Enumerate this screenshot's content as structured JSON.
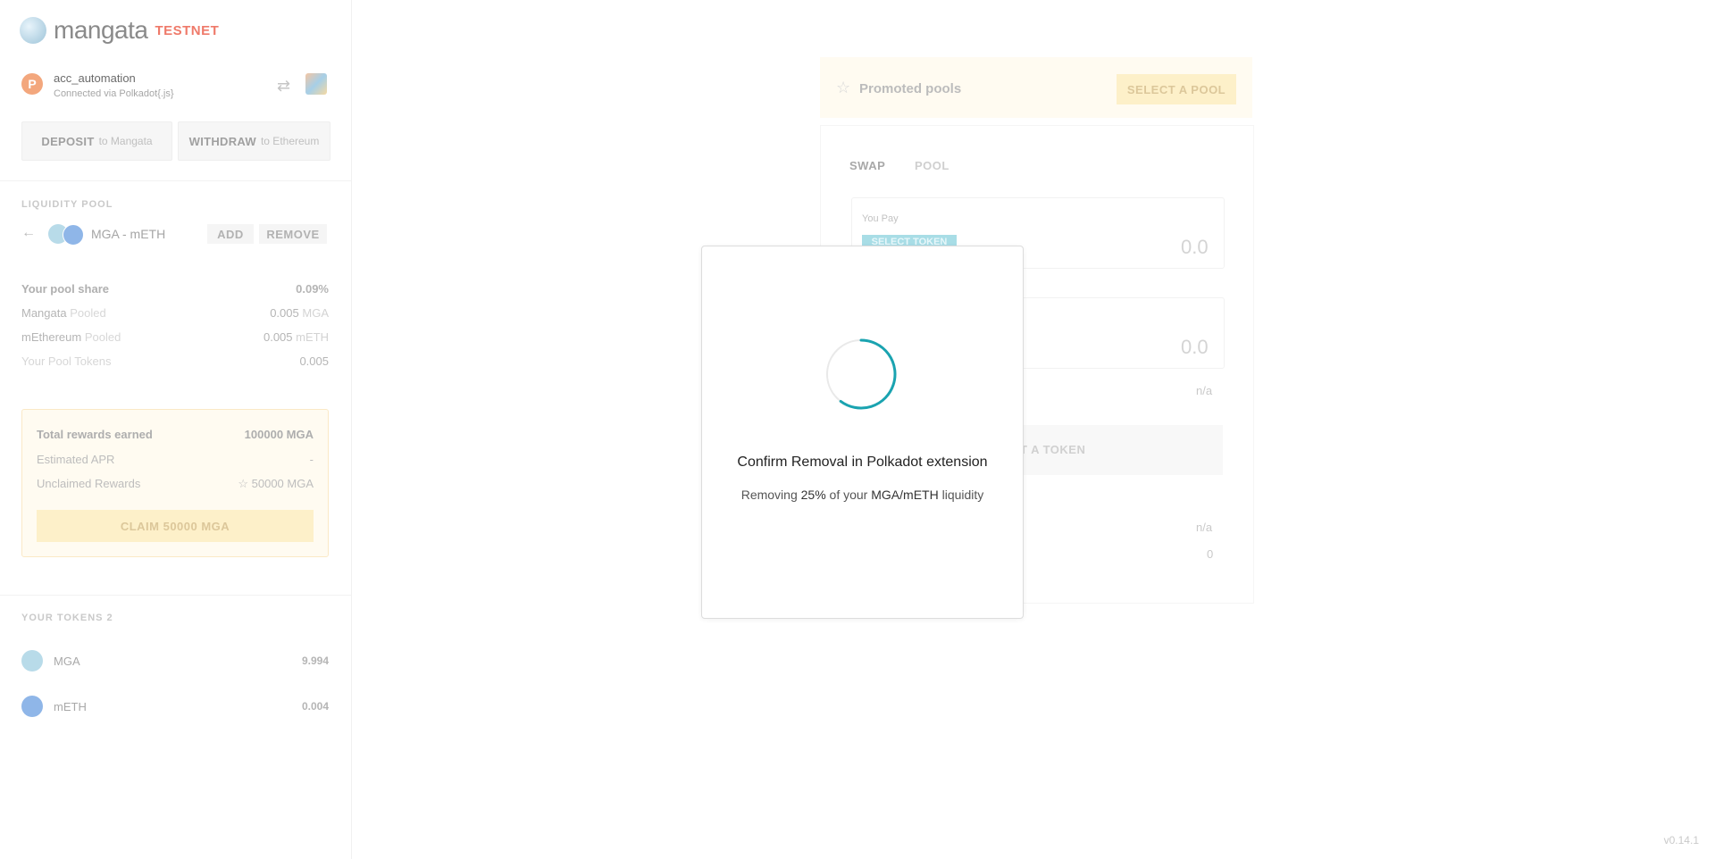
{
  "app": {
    "logo_text": "mangata",
    "badge": "TESTNET",
    "version": "v0.14.1"
  },
  "account": {
    "name": "acc_automation",
    "connection": "Connected via Polkadot{.js}",
    "avatar_letter": "P"
  },
  "actions": {
    "deposit_label": "DEPOSIT",
    "deposit_sub": "to Mangata",
    "withdraw_label": "WITHDRAW",
    "withdraw_sub": "to Ethereum"
  },
  "liquidity_pool": {
    "section_label": "LIQUIDITY POOL",
    "pair": "MGA - mETH",
    "add_label": "ADD",
    "remove_label": "REMOVE",
    "stats": [
      {
        "label": "Your pool share",
        "value": "0.09%"
      },
      {
        "label_main": "Mangata",
        "label_sub": "Pooled",
        "value": "0.005",
        "unit": "MGA"
      },
      {
        "label_main": "mEthereum",
        "label_sub": "Pooled",
        "value": "0.005",
        "unit": "mETH"
      },
      {
        "label": "Your Pool Tokens",
        "value": "0.005"
      }
    ]
  },
  "rewards": {
    "total_label": "Total rewards earned",
    "total_value": "100000 MGA",
    "apr_label": "Estimated APR",
    "apr_value": "-",
    "unclaimed_label": "Unclaimed Rewards",
    "unclaimed_value": "50000 MGA",
    "claim_label": "CLAIM 50000 MGA"
  },
  "tokens": {
    "section_label": "YOUR TOKENS 2",
    "items": [
      {
        "symbol": "MGA",
        "balance": "9.994",
        "color": "#b8dbe9"
      },
      {
        "symbol": "mETH",
        "balance": "0.004",
        "color": "#8fb6e8"
      }
    ]
  },
  "promo": {
    "title": "Promoted pools",
    "button": "SELECT A POOL"
  },
  "swap": {
    "tab_swap": "SWAP",
    "tab_pool": "POOL",
    "you_pay": "You Pay",
    "select_token": "SELECT TOKEN",
    "amount_1": "0.0",
    "amount_2": "0.0",
    "na_1": "n/a",
    "select_bar": "T A TOKEN",
    "na_2": "n/a",
    "zero": "0"
  },
  "modal": {
    "title": "Confirm Removal in Polkadot extension",
    "sub_prefix": "Removing",
    "sub_percent": "25%",
    "sub_mid": "of your",
    "sub_pair": "MGA/mETH",
    "sub_suffix": "liquidity",
    "spinner_color": "#1aa3b0"
  }
}
